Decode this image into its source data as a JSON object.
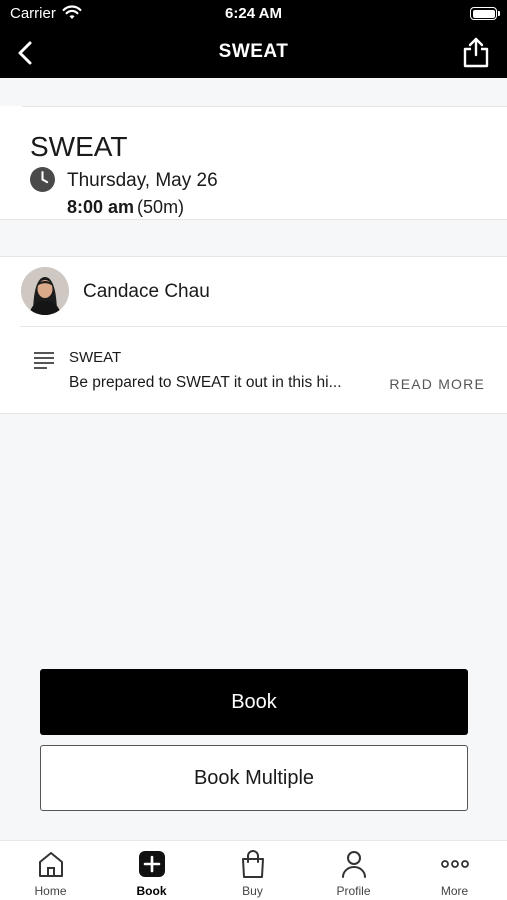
{
  "status_bar": {
    "carrier": "Carrier",
    "time": "6:24 AM"
  },
  "nav": {
    "title": "SWEAT"
  },
  "class_info": {
    "title": "SWEAT",
    "date": "Thursday, May 26",
    "start_time": "8:00 am",
    "duration": "(50m)"
  },
  "instructor": {
    "name": "Candace Chau"
  },
  "description": {
    "title": "SWEAT",
    "preview": "Be prepared to SWEAT it out in this hi...",
    "read_more": "READ MORE"
  },
  "actions": {
    "book": "Book",
    "book_multiple": "Book Multiple"
  },
  "tabs": [
    {
      "label": "Home",
      "icon": "home-icon"
    },
    {
      "label": "Book",
      "icon": "plus-square-icon",
      "active": true
    },
    {
      "label": "Buy",
      "icon": "shopping-bag-icon"
    },
    {
      "label": "Profile",
      "icon": "person-icon"
    },
    {
      "label": "More",
      "icon": "more-dots-icon"
    }
  ],
  "colors": {
    "header_bg": "#000000",
    "primary_button": "#000000",
    "page_bg": "#f6f7f9"
  }
}
